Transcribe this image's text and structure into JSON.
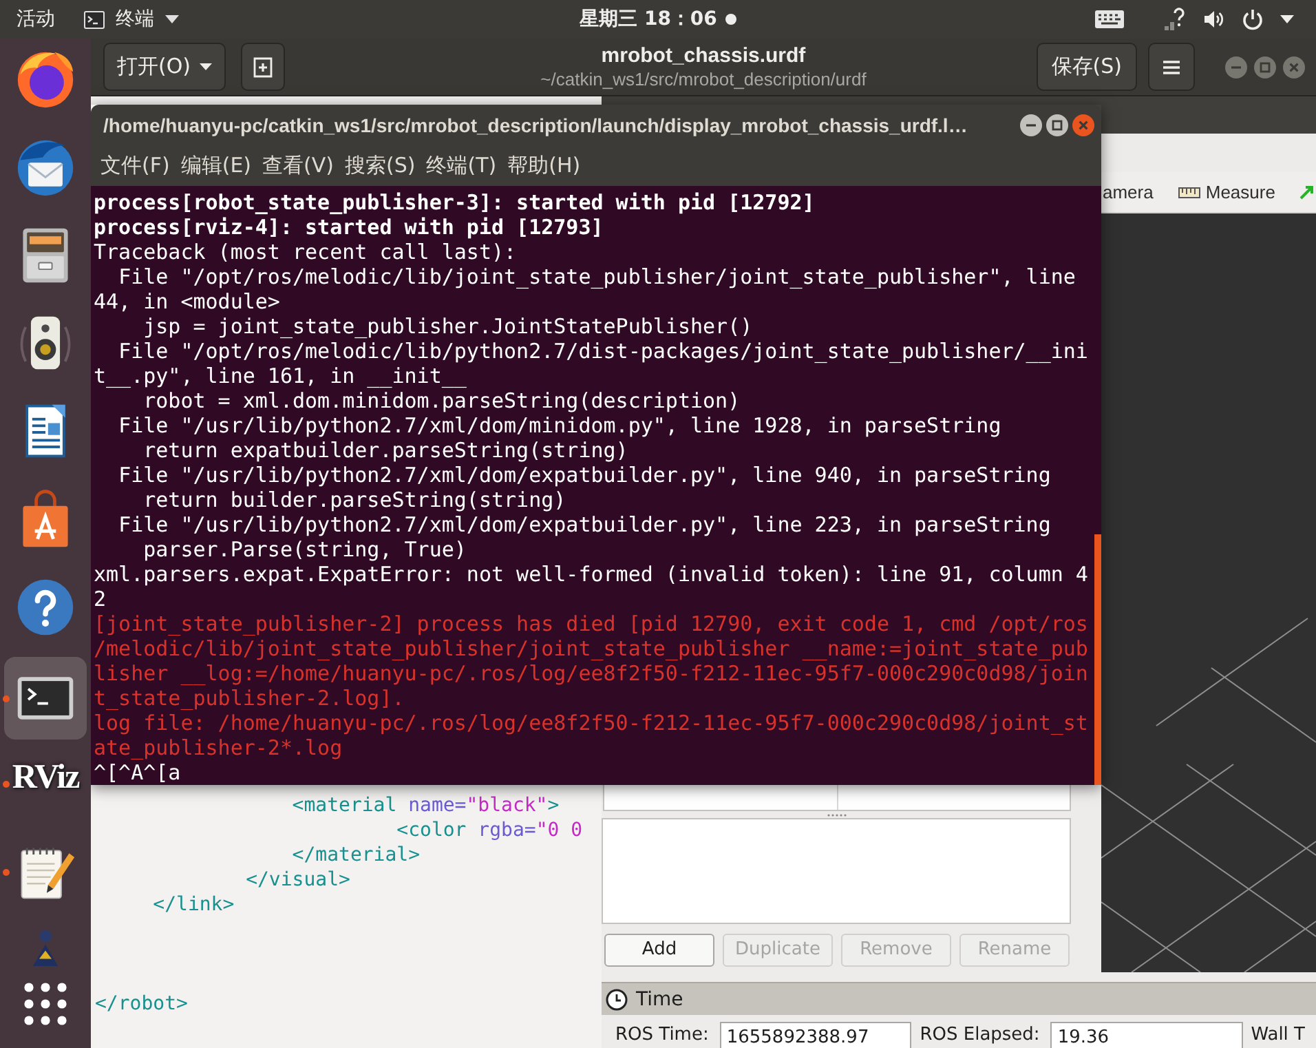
{
  "top_bar": {
    "activities": "活动",
    "app_menu": "终端",
    "clock": "星期三 18：06",
    "notification": true
  },
  "dock": {
    "items": [
      {
        "kind": "browser",
        "running": false,
        "focused": false
      },
      {
        "kind": "mail",
        "running": false,
        "focused": false
      },
      {
        "kind": "files",
        "running": false,
        "focused": false
      },
      {
        "kind": "music",
        "running": false,
        "focused": false
      },
      {
        "kind": "writer",
        "running": false,
        "focused": false
      },
      {
        "kind": "store",
        "running": false,
        "focused": false
      },
      {
        "kind": "help",
        "running": false,
        "focused": false
      },
      {
        "kind": "terminal",
        "running": true,
        "focused": true
      },
      {
        "kind": "logo",
        "label": "RViz",
        "running": true,
        "focused": false
      },
      {
        "kind": "editor",
        "running": true,
        "focused": false
      },
      {
        "kind": "figure",
        "running": false,
        "focused": false
      },
      {
        "kind": "grid",
        "running": false,
        "focused": false
      }
    ]
  },
  "gedit": {
    "focused": false,
    "open_button": "打开(O)",
    "title": "mrobot_chassis.urdf",
    "subtitle": "~/catkin_ws1/src/mrobot_description/urdf",
    "save_button": "保存(S)",
    "code_lines": [
      {
        "kind": "code",
        "parts": [
          {
            "kind": "tag",
            "text": "                 <material"
          },
          {
            "kind": "attribute",
            "text": " name="
          },
          {
            "kind": "string",
            "text": "\"black\""
          },
          {
            "kind": "tag",
            "text": ">"
          }
        ]
      },
      {
        "kind": "code",
        "parts": [
          {
            "kind": "tag",
            "text": "                          <color"
          },
          {
            "kind": "attribute",
            "text": " rgba="
          },
          {
            "kind": "string",
            "text": "\"0 0"
          }
        ]
      },
      {
        "kind": "code",
        "parts": [
          {
            "kind": "tag",
            "text": "                 </material>"
          }
        ]
      },
      {
        "kind": "code",
        "parts": [
          {
            "kind": "tag",
            "text": "             </visual>"
          }
        ]
      },
      {
        "kind": "code",
        "parts": [
          {
            "kind": "tag",
            "text": "     </link>"
          }
        ]
      },
      {
        "kind": "blank"
      },
      {
        "kind": "blank"
      },
      {
        "kind": "blank"
      },
      {
        "kind": "code",
        "parts": [
          {
            "kind": "tag",
            "text": "</robot>"
          }
        ]
      }
    ]
  },
  "terminal": {
    "focused": true,
    "title": "/home/huanyu-pc/catkin_ws1/src/mrobot_description/launch/display_mrobot_chassis_urdf.l…",
    "menu": [
      "文件(F)",
      "编辑(E)",
      "查看(V)",
      "搜索(S)",
      "终端(T)",
      "帮助(H)"
    ],
    "lines": [
      {
        "kind": "status",
        "text": "process[robot_state_publisher-3]: started with pid [12792]"
      },
      {
        "kind": "status",
        "text": "process[rviz-4]: started with pid [12793]"
      },
      {
        "kind": "plain",
        "text": "Traceback (most recent call last):"
      },
      {
        "kind": "plain",
        "text": "  File \"/opt/ros/melodic/lib/joint_state_publisher/joint_state_publisher\", line"
      },
      {
        "kind": "plain",
        "text": "44, in <module>"
      },
      {
        "kind": "plain",
        "text": "    jsp = joint_state_publisher.JointStatePublisher()"
      },
      {
        "kind": "plain",
        "text": "  File \"/opt/ros/melodic/lib/python2.7/dist-packages/joint_state_publisher/__ini"
      },
      {
        "kind": "plain",
        "text": "t__.py\", line 161, in __init__"
      },
      {
        "kind": "plain",
        "text": "    robot = xml.dom.minidom.parseString(description)"
      },
      {
        "kind": "plain",
        "text": "  File \"/usr/lib/python2.7/xml/dom/minidom.py\", line 1928, in parseString"
      },
      {
        "kind": "plain",
        "text": "    return expatbuilder.parseString(string)"
      },
      {
        "kind": "plain",
        "text": "  File \"/usr/lib/python2.7/xml/dom/expatbuilder.py\", line 940, in parseString"
      },
      {
        "kind": "plain",
        "text": "    return builder.parseString(string)"
      },
      {
        "kind": "plain",
        "text": "  File \"/usr/lib/python2.7/xml/dom/expatbuilder.py\", line 223, in parseString"
      },
      {
        "kind": "plain",
        "text": "    parser.Parse(string, True)"
      },
      {
        "kind": "plain",
        "text": "xml.parsers.expat.ExpatError: not well-formed (invalid token): line 91, column 4"
      },
      {
        "kind": "plain",
        "text": "2"
      },
      {
        "kind": "error",
        "text": "[joint_state_publisher-2] process has died [pid 12790, exit code 1, cmd /opt/ros"
      },
      {
        "kind": "error",
        "text": "/melodic/lib/joint_state_publisher/joint_state_publisher __name:=joint_state_pub"
      },
      {
        "kind": "error",
        "text": "lisher __log:=/home/huanyu-pc/.ros/log/ee8f2f50-f212-11ec-95f7-000c290c0d98/join"
      },
      {
        "kind": "error",
        "text": "t_state_publisher-2.log]."
      },
      {
        "kind": "error",
        "text": "log file: /home/huanyu-pc/.ros/log/ee8f2f50-f212-11ec-95f7-000c290c0d98/joint_st"
      },
      {
        "kind": "error",
        "text": "ate_publisher-2*.log"
      },
      {
        "kind": "plain",
        "text": "^[^A^[a"
      }
    ]
  },
  "rviz": {
    "toolbar": [
      {
        "kind": "plain",
        "label": "amera"
      },
      {
        "kind": "ruler",
        "label": "Measure"
      },
      {
        "kind": "arrow"
      }
    ],
    "display_buttons": [
      {
        "label": "Add",
        "disabled": false
      },
      {
        "label": "Duplicate",
        "disabled": true
      },
      {
        "label": "Remove",
        "disabled": true
      },
      {
        "label": "Rename",
        "disabled": true
      }
    ],
    "time_panel": {
      "title": "Time",
      "fields": [
        {
          "label": "ROS Time:",
          "value": "1655892388.97"
        },
        {
          "label": "ROS Elapsed:",
          "value": "19.36"
        },
        {
          "label": "Wall T"
        }
      ]
    }
  }
}
